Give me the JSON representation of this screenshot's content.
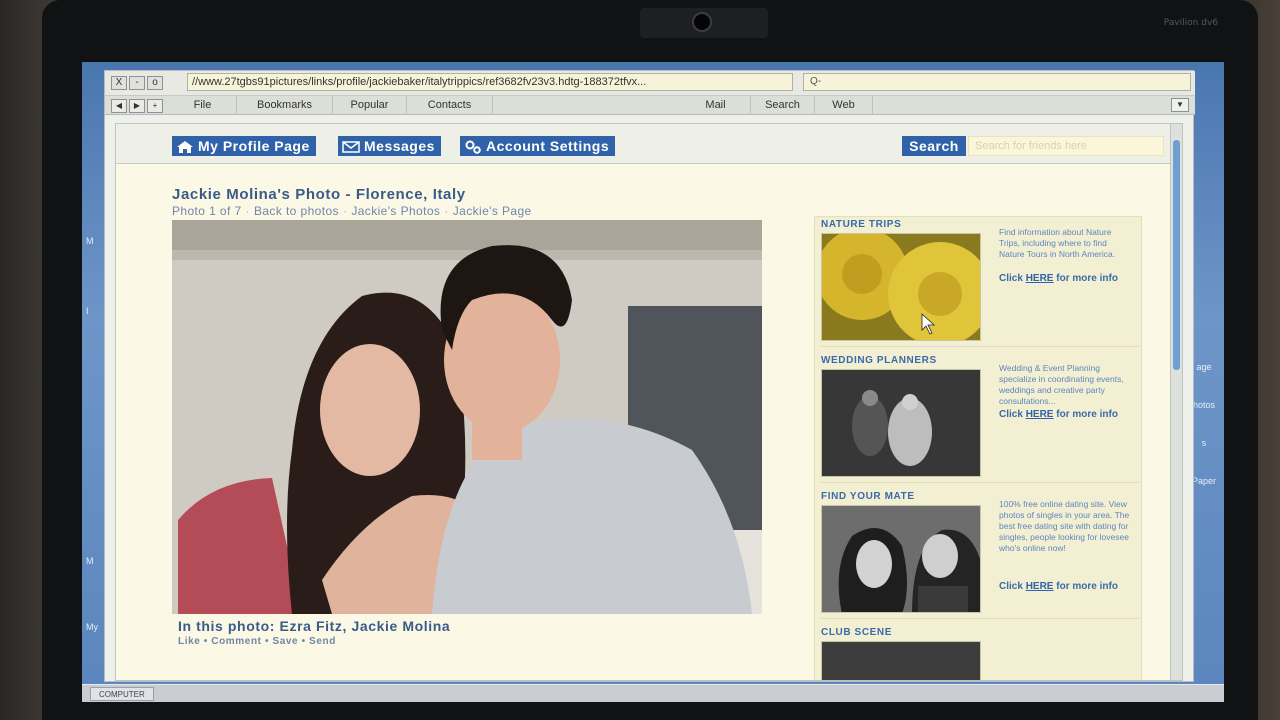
{
  "browser": {
    "url": "//www.27tgbs91pictures/links/profile/jackiebaker/italytrippics/ref3682fv23v3.hdtg-188372tfvx...",
    "search_placeholder": "Q-",
    "window_buttons": [
      "X",
      "-",
      "o"
    ],
    "nav_buttons": [
      "◀",
      "▶",
      "+"
    ],
    "menu": [
      "File",
      "Bookmarks",
      "Popular",
      "Contacts",
      "Mail",
      "Search",
      "Web"
    ],
    "menu_dropdown": "▼"
  },
  "site_nav": {
    "profile": "My Profile Page",
    "messages": "Messages",
    "account": "Account Settings",
    "search_button": "Search",
    "search_placeholder": "Search for friends here"
  },
  "photo": {
    "title": "Jackie Molina's Photo - Florence, Italy",
    "crumbs": [
      "Photo 1 of 7",
      "Back to photos",
      "Jackie's Photos",
      "Jackie's Page"
    ],
    "caption": "In this photo: Ezra Fitz, Jackie Molina",
    "actions": "Like • Comment • Save • Send"
  },
  "sidebar": {
    "ads": [
      {
        "title": "NATURE TRIPS",
        "text": "Find information about Nature Trips, including where to find Nature Tours in North America.",
        "link_pre": "Click",
        "link_here": "HERE",
        "link_post": "for more info"
      },
      {
        "title": "WEDDING PLANNERS",
        "text": "Wedding & Event Planning specialize in coordinating events, weddings and creative party consultations...",
        "link_pre": "Click",
        "link_here": "HERE",
        "link_post": "for more info"
      },
      {
        "title": "FIND YOUR MATE",
        "text": "100% free online dating site. View photos of singles in your area. The best free dating site with dating for singles, people looking for lovesee who's online now!",
        "link_pre": "Click",
        "link_here": "HERE",
        "link_post": "for more info"
      },
      {
        "title": "CLUB SCENE",
        "text": "",
        "link_pre": "",
        "link_here": "",
        "link_post": ""
      }
    ]
  },
  "desktop": {
    "left_labels": [
      "M",
      "I",
      "M",
      "My"
    ],
    "right_labels": [
      "age",
      "hotos",
      "s",
      "Paper"
    ],
    "taskbar_button": "COMPUTER"
  },
  "device": {
    "brand": "Pavilion dv6"
  },
  "colors": {
    "accent": "#2f62a8",
    "page_bg": "#fbf8e6",
    "link_text": "#3a6aa8"
  }
}
